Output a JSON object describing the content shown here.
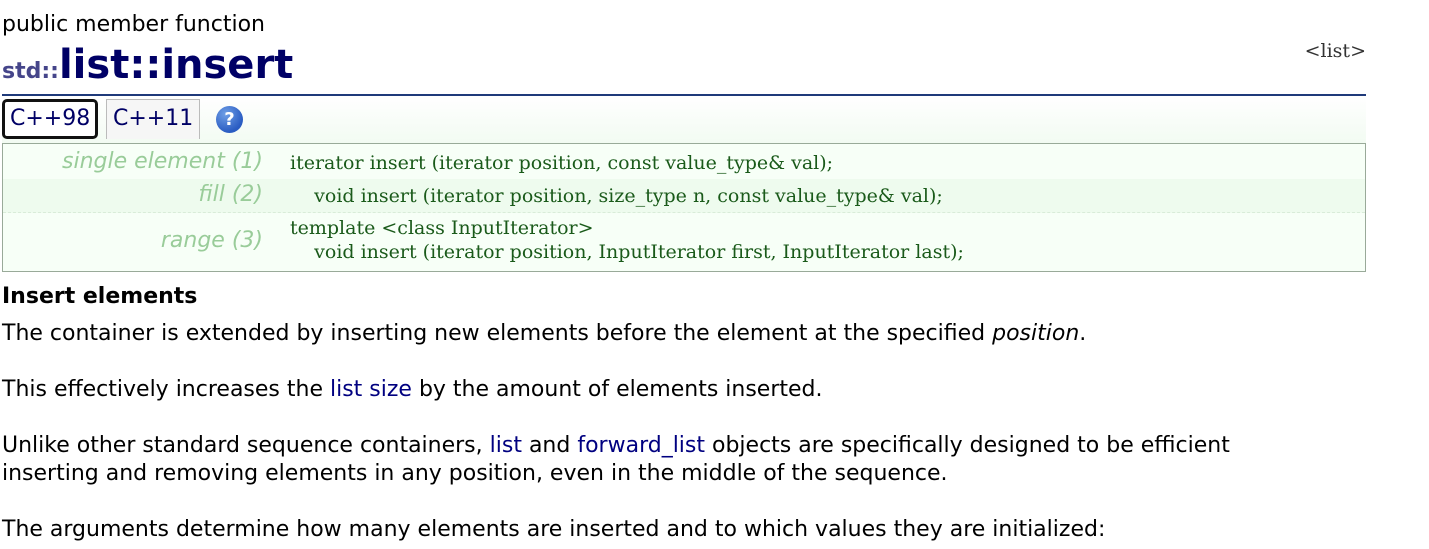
{
  "header": {
    "kind": "public member function",
    "namespace": "std::",
    "name": "list::insert",
    "header_link": "<list>"
  },
  "tabs": [
    {
      "label": "C++98",
      "active": true
    },
    {
      "label": "C++11",
      "active": false
    }
  ],
  "help_icon": {
    "glyph": "?",
    "icon": "help-icon"
  },
  "prototypes": [
    {
      "label": "single element (1)",
      "lines": [
        "iterator insert (iterator position, const value_type& val);"
      ]
    },
    {
      "label": "fill (2)",
      "lines": [
        "    void insert (iterator position, size_type n, const value_type& val);"
      ]
    },
    {
      "label": "range (3)",
      "lines": [
        "template <class InputIterator>",
        "    void insert (iterator position, InputIterator first, InputIterator last);"
      ]
    }
  ],
  "description": {
    "title": "Insert elements",
    "p1": {
      "text_before": "The container is extended by inserting new elements before the element at the specified ",
      "param": "position",
      "text_after": "."
    },
    "p2": {
      "text_before": "This effectively increases the ",
      "link": "list size",
      "text_after": " by the amount of elements inserted."
    },
    "p3": {
      "text_before": "Unlike other standard sequence containers, ",
      "link1": "list",
      "text_mid": " and ",
      "link2": "forward_list",
      "text_after": " objects are specifically designed to be efficient",
      "line2": "inserting and removing elements in any position, even in the middle of the sequence."
    },
    "p4": {
      "text": "The arguments determine how many elements are inserted and to which values they are initialized:"
    }
  },
  "colors": {
    "title": "#000066",
    "namespace": "#45458a",
    "link": "#000080",
    "proto_label": "#99cc99",
    "proto_code": "#1a5a1a",
    "rule": "#1f3a7a"
  }
}
